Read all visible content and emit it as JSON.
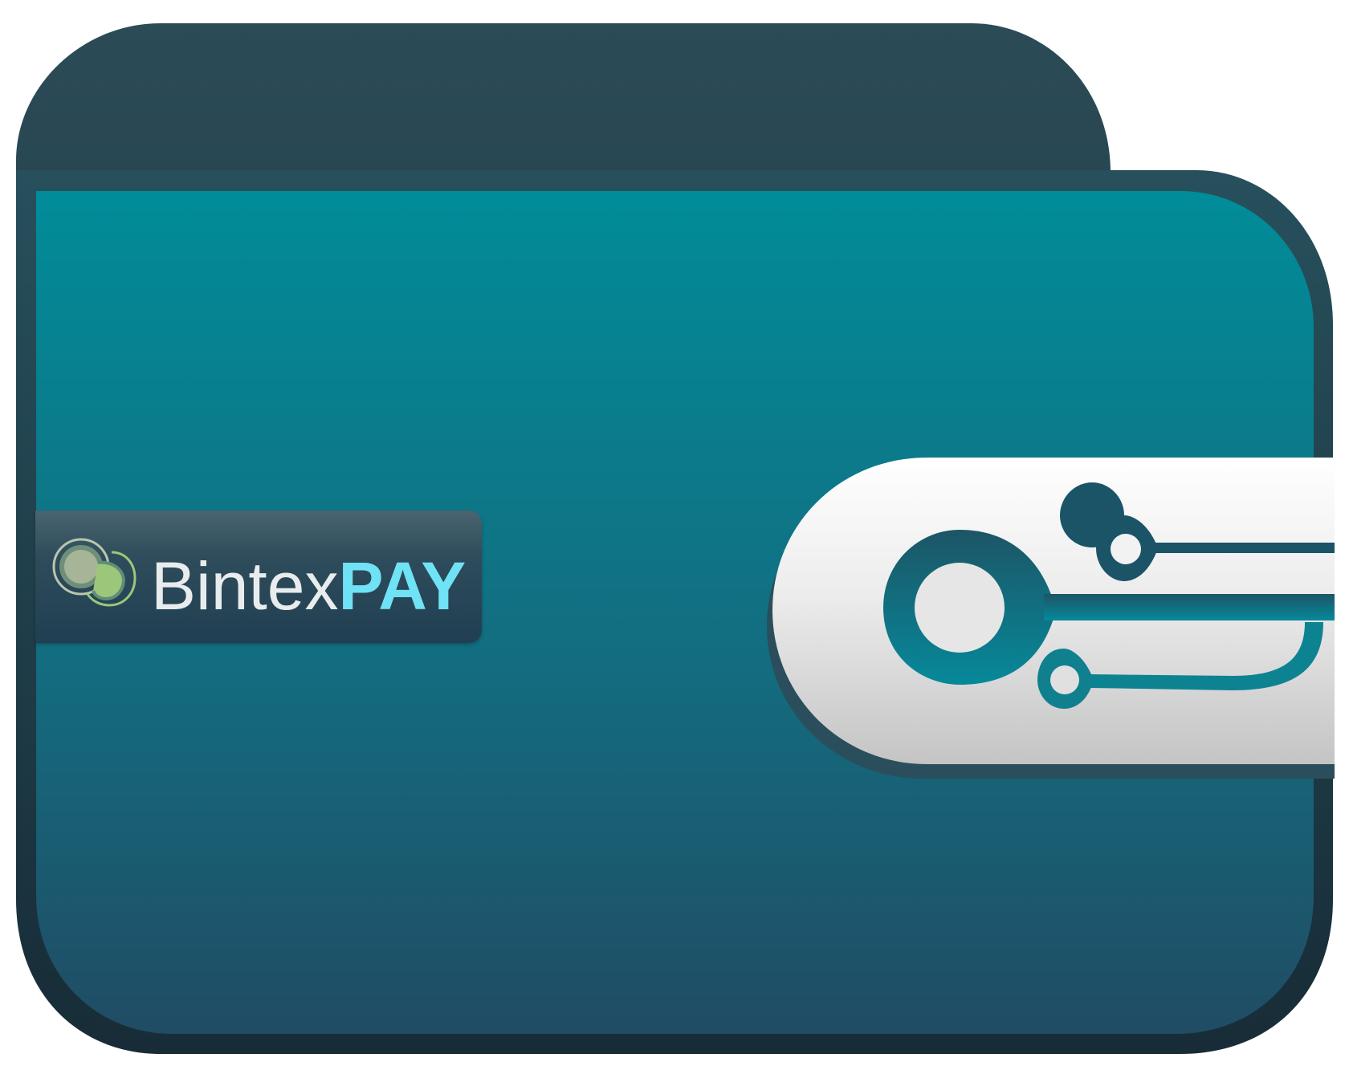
{
  "brand": {
    "name_part1": "Bintex",
    "name_part2": "PAY"
  },
  "icons": {
    "wallet": "wallet-icon",
    "logo": "bintex-logo-icon",
    "clasp": "circuit-clasp-icon"
  },
  "colors": {
    "wallet_top": "#018c99",
    "wallet_bottom": "#204c64",
    "wallet_border": "#233d4a",
    "flap_back": "#294a56",
    "clasp_light": "#ffffff",
    "clasp_dark": "#c6c6c6",
    "brand_accent": "#6fe3f5",
    "brand_text": "#e9ecec",
    "logo_green": "#9cc77a"
  }
}
